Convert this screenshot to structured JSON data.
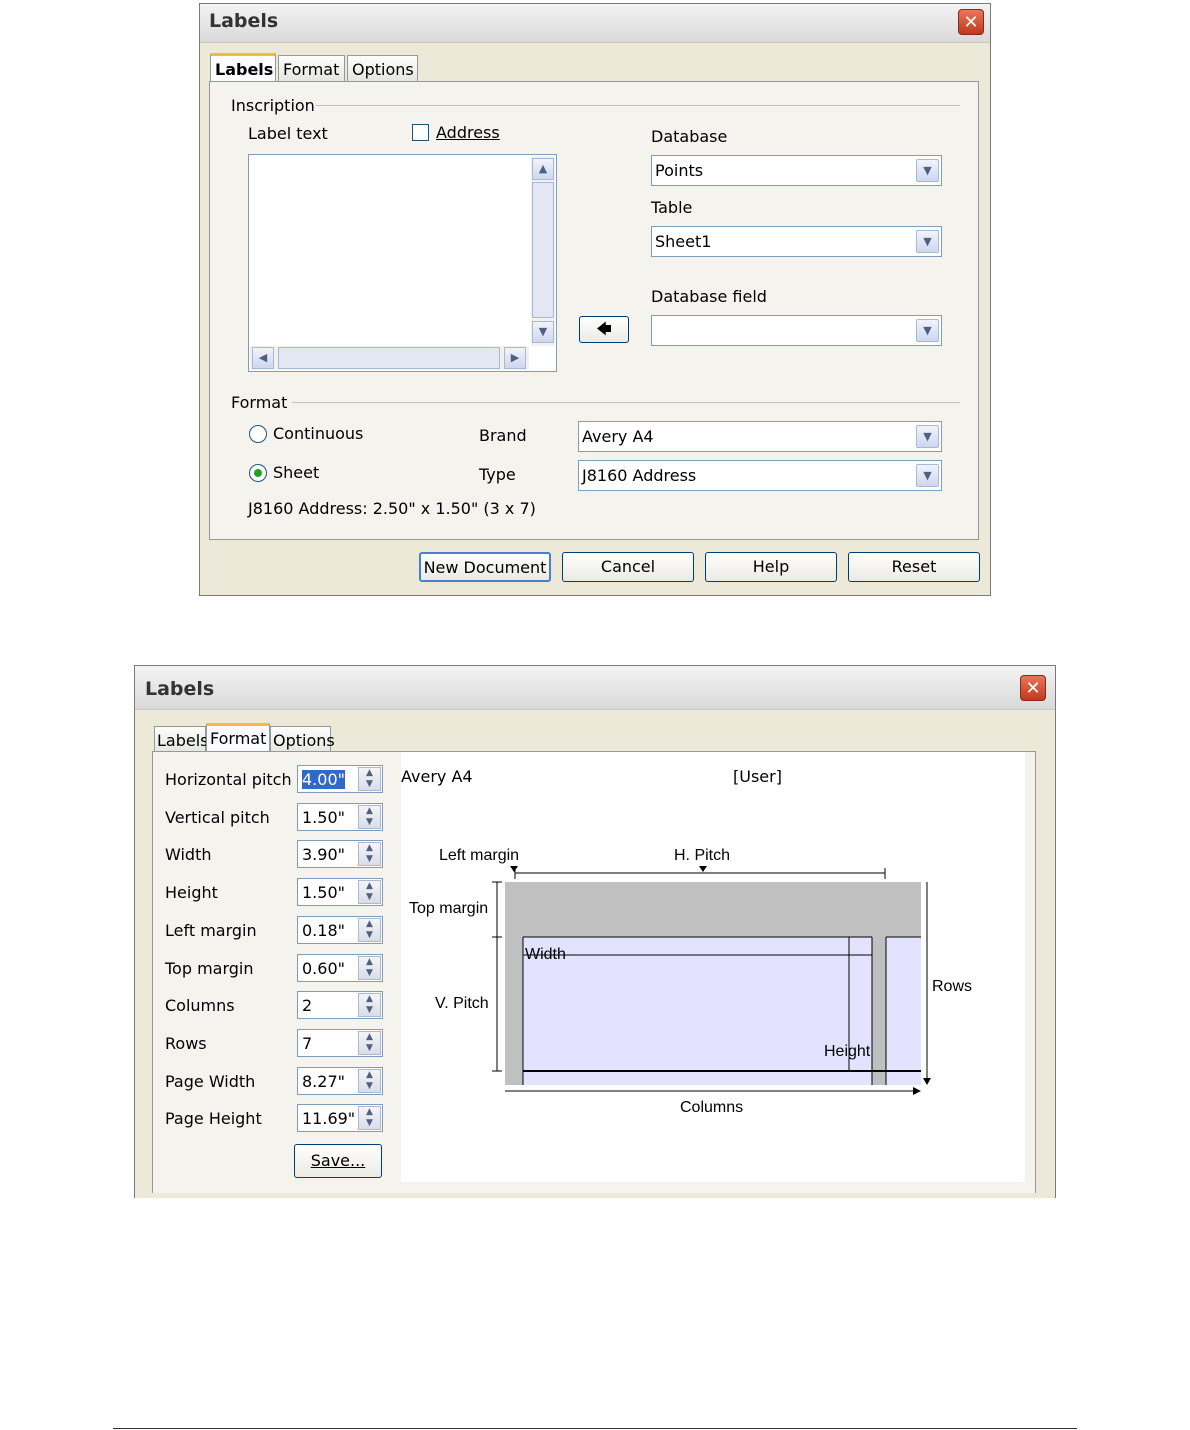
{
  "dialog1": {
    "title": "Labels",
    "close_glyph": "✕",
    "tabs": [
      {
        "label": "Labels",
        "active": true
      },
      {
        "label": "Format",
        "active": false
      },
      {
        "label": "Options",
        "active": false
      }
    ],
    "inscription_label": "Inscription",
    "label_text_label": "Label text",
    "address_checkbox": {
      "label": "Address",
      "checked": false
    },
    "label_text_value": "",
    "database": {
      "label": "Database",
      "value": "Points"
    },
    "table": {
      "label": "Table",
      "value": "Sheet1"
    },
    "database_field": {
      "label": "Database field",
      "value": ""
    },
    "insert_arrow_glyph": "🡄",
    "format_label": "Format",
    "continuous_radio": {
      "label": "Continuous",
      "selected": false
    },
    "sheet_radio": {
      "label": "Sheet",
      "selected": true
    },
    "brand": {
      "label": "Brand",
      "value": "Avery A4"
    },
    "type": {
      "label": "Type",
      "value": "J8160 Address"
    },
    "summary": "J8160 Address: 2.50\" x 1.50\" (3 x 7)",
    "buttons": {
      "new_document": "New Document",
      "cancel": "Cancel",
      "help": "Help",
      "reset": "Reset"
    }
  },
  "dialog2": {
    "title": "Labels",
    "close_glyph": "✕",
    "tabs": [
      {
        "label": "Labels",
        "active": false
      },
      {
        "label": "Format",
        "active": true
      },
      {
        "label": "Options",
        "active": false
      }
    ],
    "fields": [
      {
        "label": "Horizontal pitch",
        "value": "4.00\""
      },
      {
        "label": "Vertical pitch",
        "value": "1.50\""
      },
      {
        "label": "Width",
        "value": "3.90\""
      },
      {
        "label": "Height",
        "value": "1.50\""
      },
      {
        "label": "Left margin",
        "value": "0.18\""
      },
      {
        "label": "Top margin",
        "value": "0.60\""
      },
      {
        "label": "Columns",
        "value": "2"
      },
      {
        "label": "Rows",
        "value": "7"
      },
      {
        "label": "Page Width",
        "value": "8.27\""
      },
      {
        "label": "Page Height",
        "value": "11.69\""
      }
    ],
    "save_button": "Save...",
    "preview": {
      "brand": "Avery A4",
      "type": "[User]",
      "left_margin": "Left margin",
      "h_pitch": "H. Pitch",
      "top_margin": "Top margin",
      "width": "Width",
      "rows": "Rows",
      "v_pitch": "V. Pitch",
      "height": "Height",
      "columns": "Columns",
      "colors": {
        "page": "#c0c0c0",
        "label": "#e3e3ff"
      }
    }
  },
  "icons": {
    "scroll_up": "▲",
    "scroll_down": "▼",
    "scroll_left": "◀",
    "scroll_right": "▶",
    "combo_arrow": "▼",
    "spin": "▲▼"
  }
}
